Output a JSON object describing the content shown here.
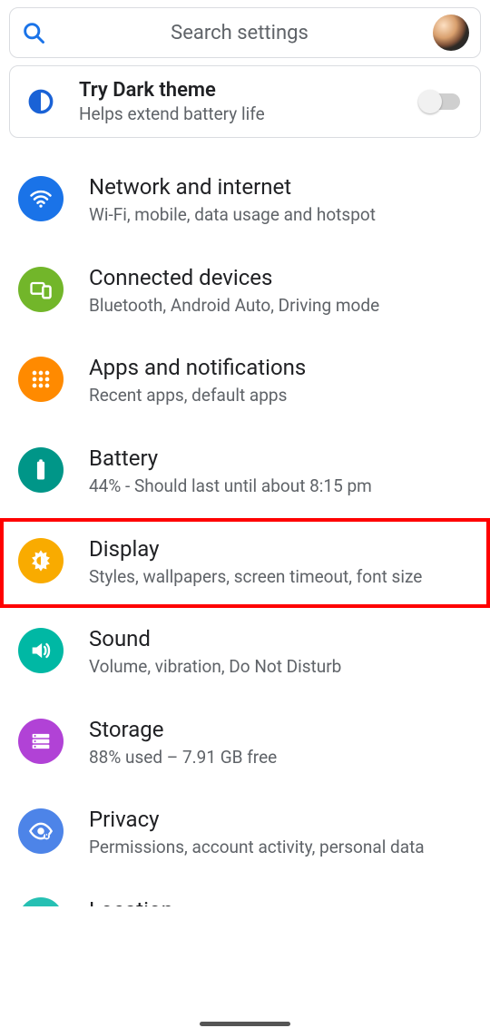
{
  "search": {
    "placeholder": "Search settings"
  },
  "promo": {
    "title": "Try Dark theme",
    "subtitle": "Helps extend battery life"
  },
  "items": [
    {
      "id": "network",
      "title": "Network and internet",
      "subtitle": "Wi-Fi, mobile, data usage and hotspot"
    },
    {
      "id": "devices",
      "title": "Connected devices",
      "subtitle": "Bluetooth, Android Auto, Driving mode"
    },
    {
      "id": "apps",
      "title": "Apps and notifications",
      "subtitle": "Recent apps, default apps"
    },
    {
      "id": "battery",
      "title": "Battery",
      "subtitle": "44% - Should last until about 8:15 pm"
    },
    {
      "id": "display",
      "title": "Display",
      "subtitle": "Styles, wallpapers, screen timeout, font size"
    },
    {
      "id": "sound",
      "title": "Sound",
      "subtitle": "Volume, vibration, Do Not Disturb"
    },
    {
      "id": "storage",
      "title": "Storage",
      "subtitle": "88% used – 7.91 GB free"
    },
    {
      "id": "privacy",
      "title": "Privacy",
      "subtitle": "Permissions, account activity, personal data"
    },
    {
      "id": "location",
      "title": "Location",
      "subtitle": ""
    }
  ],
  "highlight_id": "display"
}
